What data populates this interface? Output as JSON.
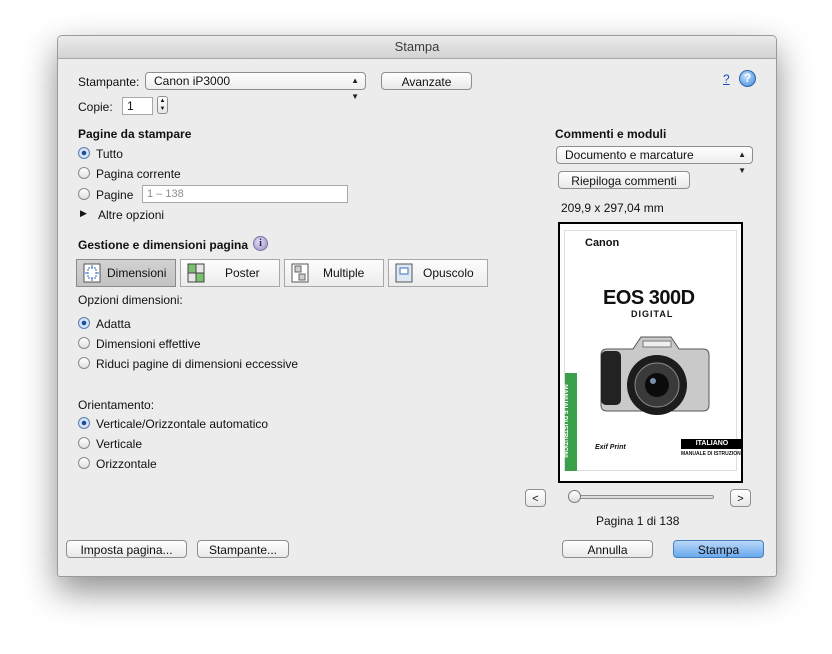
{
  "window": {
    "title": "Stampa"
  },
  "printer": {
    "label": "Stampante:",
    "value": "Canon iP3000",
    "advanced_button": "Avanzate"
  },
  "help": {
    "question": "?"
  },
  "copies": {
    "label": "Copie:",
    "value": "1"
  },
  "pages": {
    "heading": "Pagine da stampare",
    "option_all": "Tutto",
    "option_current": "Pagina corrente",
    "option_range": "Pagine",
    "range_placeholder": "1 – 138",
    "more_options": "Altre opzioni",
    "selected": "all"
  },
  "page_handling": {
    "heading": "Gestione e dimensioni pagina",
    "tiles": [
      "Dimensioni",
      "Poster",
      "Multiple",
      "Opuscolo"
    ],
    "selected_tile": "Dimensioni"
  },
  "size_options": {
    "label": "Opzioni dimensioni:",
    "options": [
      "Adatta",
      "Dimensioni effettive",
      "Riduci pagine di dimensioni eccessive"
    ],
    "selected": "Adatta"
  },
  "orientation": {
    "label": "Orientamento:",
    "options": [
      "Verticale/Orizzontale automatico",
      "Verticale",
      "Orizzontale"
    ],
    "selected": "Verticale/Orizzontale automatico"
  },
  "comments": {
    "heading": "Commenti e moduli",
    "popup_value": "Documento e marcature",
    "summary_button": "Riepiloga commenti",
    "page_size": "209,9 x 297,04 mm"
  },
  "preview": {
    "brand": "Canon",
    "model": "EOS 300D",
    "model_sub": "DIGITAL",
    "side_text": "MANUALE DI ISTRUZIONI",
    "language_badge": "ITALIANO",
    "footer_text": "MANUALE DI ISTRUZIONI",
    "exif_logo": "Exif Print",
    "current_page": 1,
    "total_pages": 138,
    "page_label": "Pagina 1 di 138"
  },
  "nav": {
    "prev": "<",
    "next": ">"
  },
  "bottom": {
    "page_setup": "Imposta pagina...",
    "printer": "Stampante...",
    "cancel": "Annulla",
    "print": "Stampa"
  }
}
